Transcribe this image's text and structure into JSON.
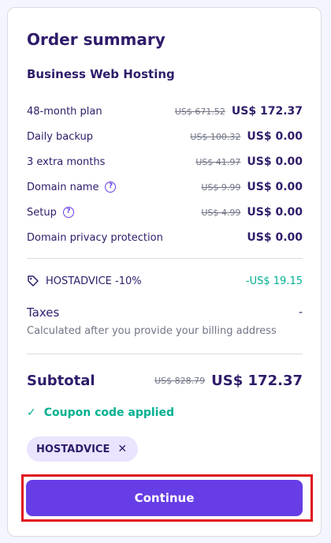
{
  "summary": {
    "title": "Order summary",
    "product": "Business Web Hosting",
    "lines": [
      {
        "label": "48-month plan",
        "old": "US$ 671.52",
        "price": "US$ 172.37",
        "help": false
      },
      {
        "label": "Daily backup",
        "old": "US$ 100.32",
        "price": "US$ 0.00",
        "help": false
      },
      {
        "label": "3 extra months",
        "old": "US$ 41.97",
        "price": "US$ 0.00",
        "help": false
      },
      {
        "label": "Domain name",
        "old": "US$ 9.99",
        "price": "US$ 0.00",
        "help": true
      },
      {
        "label": "Setup",
        "old": "US$ 4.99",
        "price": "US$ 0.00",
        "help": true
      },
      {
        "label": "Domain privacy protection",
        "old": "",
        "price": "US$ 0.00",
        "help": false
      }
    ],
    "coupon": {
      "label": "HOSTADVICE -10%",
      "discount": "-US$ 19.15"
    },
    "taxes": {
      "label": "Taxes",
      "value": "-",
      "note": "Calculated after you provide your billing address"
    },
    "subtotal": {
      "label": "Subtotal",
      "old": "US$ 828.79",
      "price": "US$ 172.37"
    },
    "applied_text": "Coupon code applied",
    "chip_code": "HOSTADVICE",
    "continue_label": "Continue"
  },
  "colors": {
    "accent": "#673de6",
    "success": "#00b090",
    "highlight": "#e0121a",
    "text": "#2f1c6a"
  }
}
